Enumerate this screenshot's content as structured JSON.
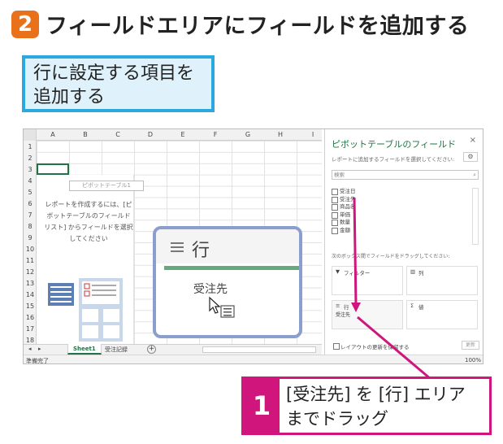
{
  "heading": {
    "step": "2",
    "text": "フィールドエリアにフィールドを追加する"
  },
  "callout": {
    "line1": "行に設定する項目を",
    "line2": "追加する"
  },
  "excel": {
    "columns": [
      "A",
      "B",
      "C",
      "D",
      "E",
      "F",
      "G",
      "H",
      "I"
    ],
    "rows": [
      "1",
      "2",
      "3",
      "4",
      "5",
      "6",
      "7",
      "8",
      "9",
      "10",
      "11",
      "12",
      "13",
      "14",
      "15",
      "16",
      "17",
      "18"
    ],
    "pivot_placeholder_title": "ピボットテーブル1",
    "pivot_hint_line1": "レポートを作成するには、[ピ",
    "pivot_hint_line2": "ボットテーブルのフィールド",
    "pivot_hint_line3": "リスト] からフィールドを選択",
    "pivot_hint_line4": "してください",
    "sheet_tab_active": "Sheet1",
    "sheet_tab_2": "受注記録",
    "add_sheet": "+",
    "status": "準備完了",
    "zoom_level": "100%"
  },
  "pane": {
    "title": "ピボットテーブルのフィールド",
    "close": "×",
    "subtitle": "レポートに追加するフィールドを選択してください:",
    "search_placeholder": "検索",
    "fields": [
      "受注日",
      "受注先",
      "商品名",
      "単価",
      "数量",
      "金額"
    ],
    "areas_hint": "次のボックス間でフィールドをドラッグしてください:",
    "filter_label": "フィルター",
    "columns_label": "列",
    "rows_label": "行",
    "values_label": "値",
    "rows_item": "受注先",
    "defer_label": "レイアウトの更新を保留する",
    "update_button": "更新"
  },
  "zoom_bubble": {
    "title": "行",
    "item": "受注先"
  },
  "instruction": {
    "num": "1",
    "line1": "[受注先] を [行] エリア",
    "line2": "までドラッグ"
  },
  "colors": {
    "step_orange": "#e8711a",
    "callout_blue": "#29a9e0",
    "callout_bg": "#dff1fb",
    "excel_green": "#217346",
    "accent_pink": "#d0157c",
    "bubble_border": "#8a9fce"
  }
}
